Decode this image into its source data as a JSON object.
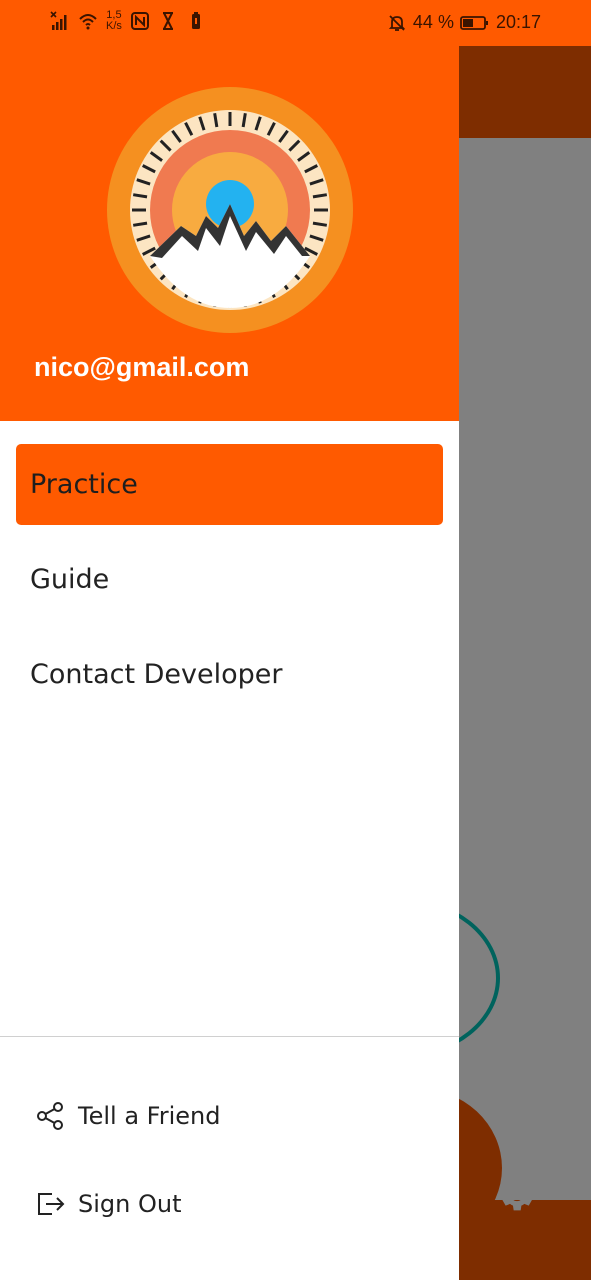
{
  "status_bar": {
    "network_speed_value": "1,5",
    "network_speed_unit": "K/s",
    "battery_percent": "44 %",
    "time": "20:17",
    "icons": [
      "signal-x-icon",
      "wifi-icon",
      "nfc-icon",
      "hourglass-icon",
      "battery-saver-icon",
      "bell-off-icon",
      "battery-icon"
    ]
  },
  "drawer": {
    "header": {
      "email": "nico@gmail.com",
      "logo_icon": "mountain-sun-logo"
    },
    "menu": [
      {
        "label": "Practice",
        "active": true
      },
      {
        "label": "Guide",
        "active": false
      },
      {
        "label": "Contact Developer",
        "active": false
      }
    ],
    "footer": [
      {
        "label": "Tell a Friend",
        "icon": "share-icon"
      },
      {
        "label": "Sign Out",
        "icon": "sign-out-icon"
      }
    ]
  },
  "background_app": {
    "settings_icon": "gear-icon"
  },
  "colors": {
    "accent": "#ff5a00",
    "scrim_toolbar": "#7e2d00",
    "scrim_content": "#808080"
  }
}
